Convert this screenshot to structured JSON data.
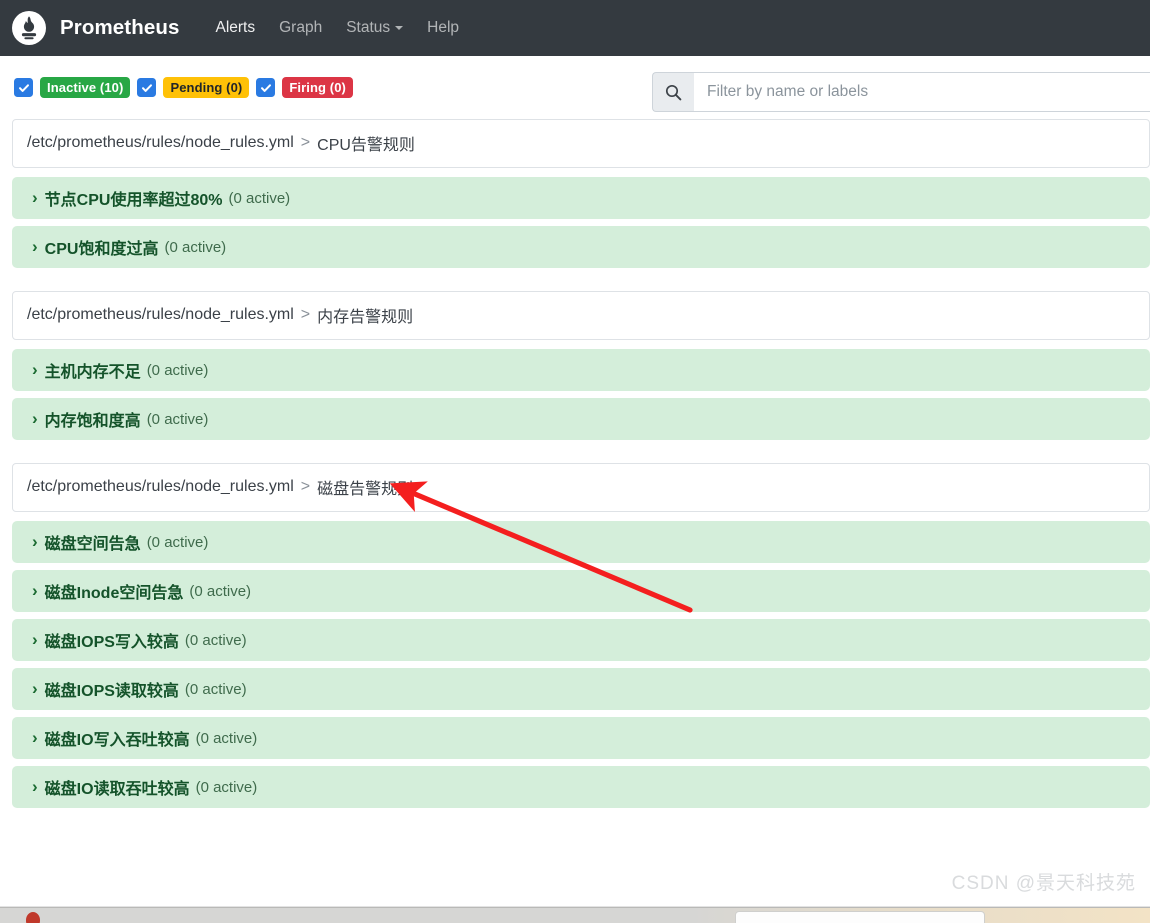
{
  "navbar": {
    "logo_icon": "prometheus-torch-logo",
    "brand": "Prometheus",
    "links": [
      {
        "label": "Alerts",
        "active": true,
        "caret": false
      },
      {
        "label": "Graph",
        "active": false,
        "caret": false
      },
      {
        "label": "Status",
        "active": false,
        "caret": true
      },
      {
        "label": "Help",
        "active": false,
        "caret": false
      }
    ]
  },
  "filterbar": {
    "states": [
      {
        "label": "Inactive (10)",
        "checked": true,
        "kind": "inactive"
      },
      {
        "label": "Pending (0)",
        "checked": true,
        "kind": "pending"
      },
      {
        "label": "Firing (0)",
        "checked": true,
        "kind": "firing"
      }
    ],
    "search": {
      "icon": "search-icon",
      "placeholder": "Filter by name or labels",
      "value": ""
    }
  },
  "colors": {
    "navbar_bg": "#343a40",
    "inactive_badge": "#28a745",
    "pending_badge": "#ffc107",
    "firing_badge": "#dc3545",
    "checkbox": "#2a7ae2",
    "alert_row_bg": "#d4eeda",
    "alert_text": "#14532a",
    "annotation_arrow": "#f41f1f",
    "watermark": "#d9dbdd"
  },
  "groups": [
    {
      "file": "/etc/prometheus/rules/node_rules.yml",
      "separator": ">",
      "name": "CPU告警规则",
      "rules": [
        {
          "name": "节点CPU使用率超过80%",
          "count": "(0 active)"
        },
        {
          "name": "CPU饱和度过高",
          "count": "(0 active)"
        }
      ]
    },
    {
      "file": "/etc/prometheus/rules/node_rules.yml",
      "separator": ">",
      "name": "内存告警规则",
      "rules": [
        {
          "name": "主机内存不足",
          "count": "(0 active)"
        },
        {
          "name": "内存饱和度高",
          "count": "(0 active)"
        }
      ]
    },
    {
      "file": "/etc/prometheus/rules/node_rules.yml",
      "separator": ">",
      "name": "磁盘告警规则",
      "rules": [
        {
          "name": "磁盘空间告急",
          "count": "(0 active)"
        },
        {
          "name": "磁盘Inode空间告急",
          "count": "(0 active)"
        },
        {
          "name": "磁盘IOPS写入较高",
          "count": "(0 active)"
        },
        {
          "name": "磁盘IOPS读取较高",
          "count": "(0 active)"
        },
        {
          "name": "磁盘IO写入吞吐较高",
          "count": "(0 active)"
        },
        {
          "name": "磁盘IO读取吞吐较高",
          "count": "(0 active)"
        }
      ]
    }
  ],
  "annotation": {
    "type": "arrow",
    "points_to": "磁盘告警规则"
  },
  "watermark": {
    "text": "CSDN @景天科技苑"
  }
}
